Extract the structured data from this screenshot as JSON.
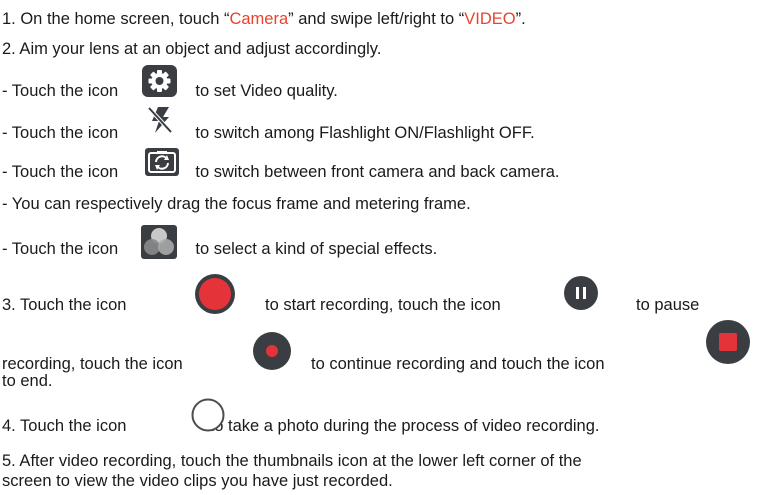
{
  "steps": {
    "s1": {
      "pre": "1. On the home screen, touch “",
      "camera": "Camera",
      "mid": "” and swipe left/right to “",
      "video": "VIDEO",
      "post": "”."
    },
    "s2": "2. Aim your lens at an object and adjust accordingly.",
    "settings": {
      "pre": "- Touch the icon",
      "post": "to set Video quality."
    },
    "flash": {
      "pre": "- Touch the icon",
      "post": "to switch among Flashlight ON/Flashlight OFF."
    },
    "switch_cam": {
      "pre": "- Touch the icon",
      "post": "to switch between front camera and back camera."
    },
    "drag": "- You can respectively drag the focus frame and metering frame.",
    "effects": {
      "pre": "- Touch the icon",
      "post": "to select a kind of special effects."
    },
    "s3": {
      "a": "3. Touch the icon",
      "b": "to start recording, touch the icon",
      "c": "to pause",
      "d": "recording, touch the icon",
      "e": "to continue recording and touch the icon",
      "f": "to end."
    },
    "s4": {
      "pre": "4. Touch the icon",
      "post": "to take a photo during the process of video recording."
    },
    "s5_line1": "5. After video recording, touch the thumbnails icon at the lower left corner of the",
    "s5_line2": "screen to view the video clips you have just recorded."
  },
  "colors": {
    "accent_red": "#e8432e",
    "record_red": "#e5333a",
    "dark_icon": "#3a3d42"
  },
  "icons": [
    "gear-icon",
    "flash-off-icon",
    "camera-switch-icon",
    "effects-icon",
    "record-icon",
    "pause-icon",
    "resume-icon",
    "stop-icon",
    "shutter-icon"
  ]
}
